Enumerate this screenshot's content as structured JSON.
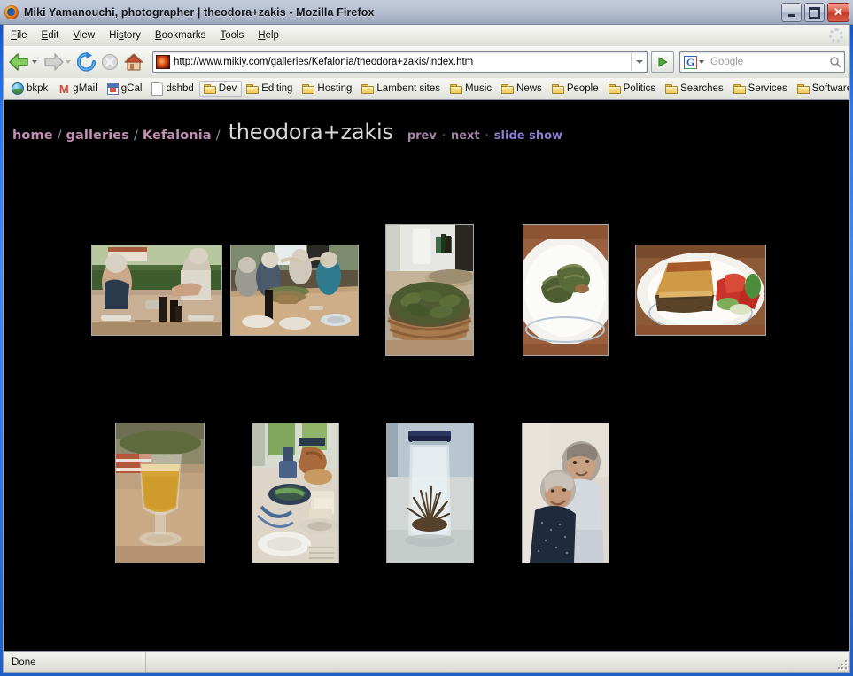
{
  "window": {
    "title": "Miki Yamanouchi, photographer  |  theodora+zakis - Mozilla Firefox",
    "icon": "firefox-logo",
    "buttons": {
      "minimize": "minimize",
      "maximize": "maximize",
      "close": "close"
    }
  },
  "menubar": {
    "items": [
      {
        "label": "File",
        "accel": "F"
      },
      {
        "label": "Edit",
        "accel": "E"
      },
      {
        "label": "View",
        "accel": "V"
      },
      {
        "label": "History",
        "accel": "s"
      },
      {
        "label": "Bookmarks",
        "accel": "B"
      },
      {
        "label": "Tools",
        "accel": "T"
      },
      {
        "label": "Help",
        "accel": "H"
      }
    ],
    "throbber": "throbber-icon"
  },
  "toolbar": {
    "back": "Back",
    "forward": "Forward",
    "reload": "Reload",
    "stop": "Stop",
    "home": "Home",
    "go": "Go",
    "url": "http://www.mikiy.com/galleries/Kefalonia/theodora+zakis/index.htm",
    "favicon": "site-favicon",
    "search_engine": "Google",
    "search_placeholder": "Google",
    "search_value": ""
  },
  "bookmarks": {
    "items": [
      {
        "label": "bkpk",
        "icon": "globe-icon",
        "pressed": false
      },
      {
        "label": "gMail",
        "icon": "gmail-icon",
        "pressed": false
      },
      {
        "label": "gCal",
        "icon": "gcal-icon",
        "pressed": false
      },
      {
        "label": "dshbd",
        "icon": "page-icon",
        "pressed": false
      },
      {
        "label": "Dev",
        "icon": "folder-icon",
        "pressed": true
      },
      {
        "label": "Editing",
        "icon": "folder-icon",
        "pressed": false
      },
      {
        "label": "Hosting",
        "icon": "folder-icon",
        "pressed": false
      },
      {
        "label": "Lambent sites",
        "icon": "folder-icon",
        "pressed": false
      },
      {
        "label": "Music",
        "icon": "folder-icon",
        "pressed": false
      },
      {
        "label": "News",
        "icon": "folder-icon",
        "pressed": false
      },
      {
        "label": "People",
        "icon": "folder-icon",
        "pressed": false
      },
      {
        "label": "Politics",
        "icon": "folder-icon",
        "pressed": false
      },
      {
        "label": "Searches",
        "icon": "folder-icon",
        "pressed": false
      },
      {
        "label": "Services",
        "icon": "folder-icon",
        "pressed": false
      },
      {
        "label": "Software",
        "icon": "folder-icon",
        "pressed": false
      }
    ],
    "overflow": "»"
  },
  "page": {
    "background": "#000000",
    "breadcrumb": [
      {
        "label": "home",
        "link": true
      },
      {
        "label": "galleries",
        "link": true
      },
      {
        "label": "Kefalonia",
        "link": true
      }
    ],
    "separator": "/",
    "title": "theodora+zakis",
    "title_color": "#d8d8d8",
    "link_color": "#c08fb4",
    "nav": [
      {
        "label": "prev",
        "color": "#a484a8"
      },
      {
        "label": "next",
        "color": "#a484a8"
      },
      {
        "label": "slide show",
        "color": "#8a7fd0"
      }
    ],
    "nav_separator": "·",
    "thumbnails": [
      {
        "alt": "Two people setting a table on a vine-covered terrace",
        "row": 1,
        "col": 1,
        "orient": "landscape"
      },
      {
        "alt": "Group of friends toasting around a long outdoor dining table",
        "row": 1,
        "col": 2,
        "orient": "landscape"
      },
      {
        "alt": "Basket of stuffed vine leaves (dolmades) on a table",
        "row": 1,
        "col": 3,
        "orient": "portrait"
      },
      {
        "alt": "Two dolmades on a white plate",
        "row": 1,
        "col": 4,
        "orient": "portrait"
      },
      {
        "alt": "Slice of moussaka with tomato salad on a plate",
        "row": 1,
        "col": 5,
        "orient": "landscape"
      },
      {
        "alt": "Glass of golden beer on a table",
        "row": 2,
        "col": 1,
        "orient": "portrait"
      },
      {
        "alt": "Table set with bread, olives and cheese by a window",
        "row": 2,
        "col": 2,
        "orient": "portrait"
      },
      {
        "alt": "Glass jar with blue lid containing dried herbs",
        "row": 2,
        "col": 3,
        "orient": "portrait"
      },
      {
        "alt": "Smiling older couple portrait",
        "row": 2,
        "col": 4,
        "orient": "portrait"
      }
    ]
  },
  "statusbar": {
    "text": "Done",
    "grip": "resize-grip"
  }
}
